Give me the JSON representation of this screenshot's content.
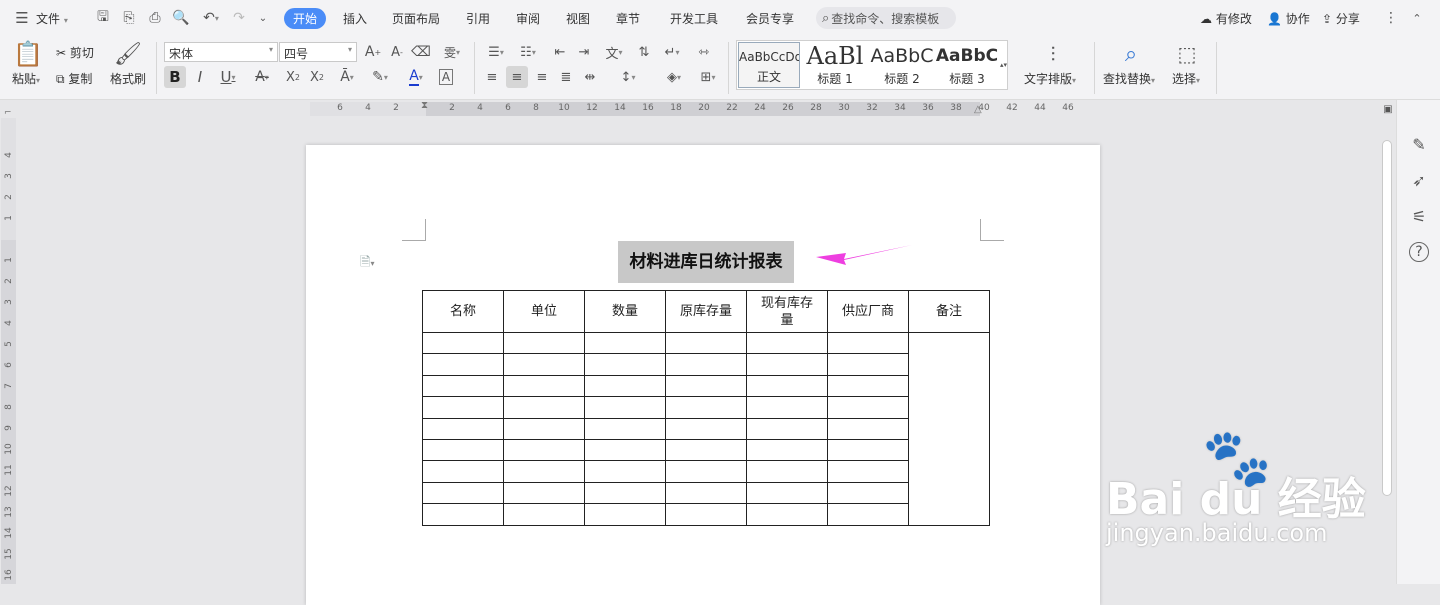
{
  "menubar": {
    "file_label": "文件",
    "tabs": [
      {
        "label": "开始",
        "active": true
      },
      {
        "label": "插入",
        "active": false
      },
      {
        "label": "页面布局",
        "active": false
      },
      {
        "label": "引用",
        "active": false
      },
      {
        "label": "审阅",
        "active": false
      },
      {
        "label": "视图",
        "active": false
      },
      {
        "label": "章节",
        "active": false
      },
      {
        "label": "开发工具",
        "active": false
      },
      {
        "label": "会员专享",
        "active": false
      }
    ],
    "search_placeholder": "查找命令、搜索模板",
    "status_label": "有修改",
    "collab_label": "协作",
    "share_label": "分享"
  },
  "ribbon": {
    "paste_label": "粘贴",
    "cut_label": "剪切",
    "copy_label": "复制",
    "format_painter_label": "格式刷",
    "font_name": "宋体",
    "font_size": "四号",
    "styles": [
      {
        "preview": "AaBbCcDd",
        "name": "正文"
      },
      {
        "preview": "AaBl",
        "name": "标题 1"
      },
      {
        "preview": "AaBbC",
        "name": "标题 2"
      },
      {
        "preview": "AaBbC",
        "name": "标题 3"
      }
    ],
    "text_layout_label": "文字排版",
    "find_replace_label": "查找替换",
    "select_label": "选择"
  },
  "ruler": {
    "h_ticks": [
      "6",
      "4",
      "2",
      "",
      "2",
      "4",
      "6",
      "8",
      "10",
      "12",
      "14",
      "16",
      "18",
      "20",
      "22",
      "24",
      "26",
      "28",
      "30",
      "32",
      "34",
      "36",
      "38",
      "40",
      "42",
      "44",
      "46"
    ],
    "v_ticks": [
      "4",
      "3",
      "2",
      "1",
      "",
      "1",
      "2",
      "3",
      "4",
      "5",
      "6",
      "7",
      "8",
      "9",
      "10",
      "11",
      "12",
      "13",
      "14",
      "15",
      "16"
    ]
  },
  "document": {
    "title": "材料进库日统计报表",
    "headers": [
      "名称",
      "单位",
      "数量",
      "原库存量",
      "现有库存量",
      "供应厂商",
      "备注"
    ],
    "empty_rows": 9
  },
  "watermark": {
    "brand": "Bai du 经验",
    "url": "jingyan.baidu.com"
  },
  "colors": {
    "accent": "#4a8cf7",
    "arrow": "#ee3fe0",
    "selection": "#c8c8c8"
  }
}
